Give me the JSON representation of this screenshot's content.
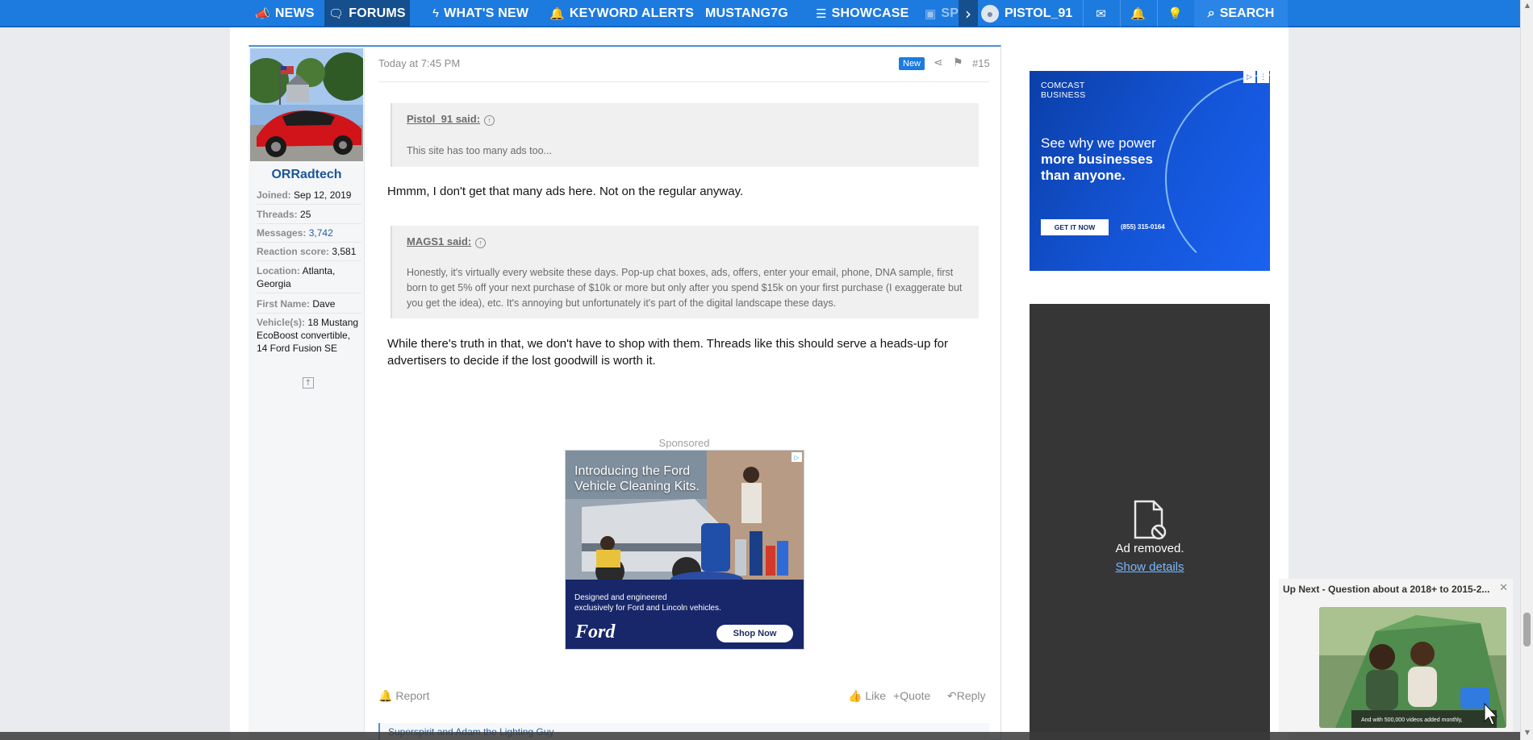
{
  "nav": {
    "items": [
      {
        "label": "NEWS",
        "icon": "megaphone-icon"
      },
      {
        "label": "FORUMS",
        "icon": "chat-bubbles-icon"
      },
      {
        "label": "WHAT'S NEW",
        "icon": "bolt-icon"
      },
      {
        "label": "KEYWORD ALERTS",
        "icon": "bell-icon"
      },
      {
        "label": "MUSTANG7G",
        "icon": ""
      },
      {
        "label": "SHOWCASE",
        "icon": "list-icon"
      },
      {
        "label": "SPO",
        "icon": "camera-icon"
      }
    ],
    "username": "PISTOL_91",
    "search_label": "SEARCH"
  },
  "user": {
    "name": "ORRadtech",
    "fields": [
      {
        "label": "Joined:",
        "value": "Sep 12, 2019"
      },
      {
        "label": "Threads:",
        "value": "25"
      },
      {
        "label": "Messages:",
        "value": "3,742"
      },
      {
        "label": "Reaction score:",
        "value": "3,581"
      },
      {
        "label": "Location:",
        "value": "Atlanta, Georgia"
      },
      {
        "label": "First Name:",
        "value": "Dave"
      },
      {
        "label": "Vehicle(s):",
        "value": "18 Mustang EcoBoost convertible, 14 Ford Fusion SE"
      }
    ]
  },
  "post": {
    "date": "Today at 7:45 PM",
    "badge": "New",
    "number": "#15",
    "quote1": {
      "author": "Pistol_91 said:",
      "text": "This site has too many ads too..."
    },
    "reply1": "Hmmm, I don't get that many ads here. Not on the regular anyway.",
    "quote2": {
      "author": "MAGS1 said:",
      "text": "Honestly, it's virtually every website these days. Pop-up chat boxes, ads, offers, enter your email, phone, DNA sample, first born to get 5% off your next purchase of $10k or more but only after you spend $15k on your first purchase (I exaggerate but you get the idea), etc. It's annoying but unfortunately it's part of the digital landscape these days."
    },
    "reply2": "While there's truth in that, we don't have to shop with them. Threads like this should serve a heads-up for advertisers to decide if the lost goodwill is worth it.",
    "sponsored_label": "Sponsored",
    "report": "Report",
    "like": "Like",
    "quote": "Quote",
    "reply": "Reply",
    "reactions": "Superspirit and Adam the Lighting Guy"
  },
  "ford_ad": {
    "headline1": "Introducing the Ford",
    "headline2": "Vehicle Cleaning Kits.",
    "sub1": "Designed and engineered",
    "sub2": "exclusively for Ford and Lincoln vehicles.",
    "logo": "Ford",
    "cta": "Shop Now"
  },
  "comcast_ad": {
    "brand1": "COMCAST",
    "brand2": "BUSINESS",
    "line1": "See why we power",
    "line2": "more businesses",
    "line3": "than anyone.",
    "cta": "GET IT NOW",
    "phone": "(855) 315-0164"
  },
  "ad_removed": {
    "message": "Ad removed.",
    "link": "Show details"
  },
  "up_next": {
    "title": "Up Next - Question about a 2018+ to 2015-2..."
  },
  "colors": {
    "nav_blue": "#1d7be0",
    "active_nav": "#154f8e",
    "username": "#1c5699",
    "new_badge": "#1d7be0"
  }
}
